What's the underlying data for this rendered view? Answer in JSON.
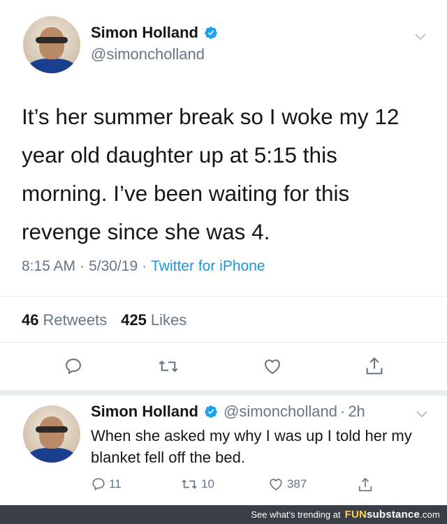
{
  "main_tweet": {
    "display_name": "Simon Holland",
    "handle": "@simoncholland",
    "text": "It’s her summer break so I woke my 12 year old daughter up at 5:15 this morning. I’ve been waiting for this revenge since she was 4.",
    "time": "8:15 AM",
    "date": "5/30/19",
    "source": "Twitter for iPhone",
    "sep": "·",
    "retweets_count": "46",
    "retweets_label": "Retweets",
    "likes_count": "425",
    "likes_label": "Likes"
  },
  "reply_tweet": {
    "display_name": "Simon Holland",
    "handle": "@simoncholland",
    "sep": "·",
    "age": "2h",
    "text": "When she asked my why I was up I told her my blanket fell off the bed.",
    "reply_count": "11",
    "retweet_count": "10",
    "like_count": "387"
  },
  "footer": {
    "prefix": "See what's trending at",
    "brand_fun": "FUN",
    "brand_sub": "substance",
    "brand_com": ".com"
  },
  "colors": {
    "verified": "#1da1f2",
    "secondary_text": "#657786",
    "link": "#1b95e0",
    "footer_bg": "#3a3f47"
  },
  "icons": [
    "verified-badge-icon",
    "chevron-down-icon",
    "reply-icon",
    "retweet-icon",
    "like-icon",
    "share-icon"
  ]
}
